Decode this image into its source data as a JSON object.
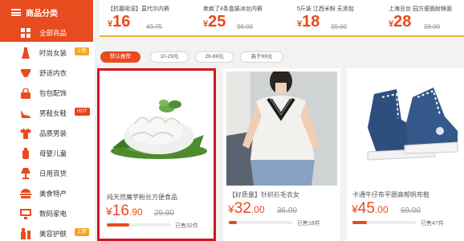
{
  "sidebar": {
    "header": "商品分类",
    "items": [
      {
        "label": "全部商品",
        "icon": "grid-icon",
        "active": true
      },
      {
        "label": "时尚女装",
        "icon": "dress-icon",
        "tag": "上新",
        "tag_type": "new"
      },
      {
        "label": "舒适内衣",
        "icon": "underwear-icon"
      },
      {
        "label": "包包配饰",
        "icon": "handbag-icon"
      },
      {
        "label": "男鞋女鞋",
        "icon": "high-heel-icon",
        "tag": "HOT",
        "tag_type": "hot"
      },
      {
        "label": "品质男装",
        "icon": "shirt-icon"
      },
      {
        "label": "母婴儿童",
        "icon": "baby-bottle-icon"
      },
      {
        "label": "日用百货",
        "icon": "lamp-icon"
      },
      {
        "label": "美食特产",
        "icon": "burger-icon"
      },
      {
        "label": "数码家电",
        "icon": "monitor-icon"
      },
      {
        "label": "美容护肤",
        "icon": "cosmetics-icon",
        "tag": "上新",
        "tag_type": "new"
      }
    ]
  },
  "deals": [
    {
      "title": "【抗菌吸湿】莫代尔内裤",
      "price_symbol": "¥",
      "price": "16",
      "old_price": "49.75"
    },
    {
      "title": "卖疯了4条盒装冰丝内裤",
      "price_symbol": "¥",
      "price": "25",
      "old_price": "98.00"
    },
    {
      "title": "5斤装 江西米粉 无添加",
      "price_symbol": "¥",
      "price": "18",
      "old_price": "39.60"
    },
    {
      "title": "上海豆丝 园方便面耐镁面",
      "price_symbol": "¥",
      "price": "28",
      "old_price": "38.00"
    }
  ],
  "filters": [
    {
      "label": "默认推荐",
      "active": true
    },
    {
      "label": "10-29元"
    },
    {
      "label": "29-69元"
    },
    {
      "label": "高于69元"
    }
  ],
  "products": [
    {
      "title": "纯天然魔芋粉丝方便食品",
      "price_symbol": "¥",
      "price_int": "16",
      "price_dec": ".90",
      "old_price": "29.90",
      "sold": "已售32件",
      "progress": 0.35,
      "selected": true
    },
    {
      "title": "【好质量】针织衫毛衣女",
      "price_symbol": "¥",
      "price_int": "32",
      "price_dec": ".00",
      "old_price": "36.00",
      "sold": "已售18件",
      "progress": 0.12
    },
    {
      "title": "卡通牛仔布平跟高帮帆布鞋",
      "price_symbol": "¥",
      "price_int": "45",
      "price_dec": ".00",
      "old_price": "69.00",
      "sold": "已售47件",
      "progress": 0.22
    }
  ],
  "colors": {
    "accent": "#e84b1e",
    "selected_border": "#d4161e",
    "topbar_border": "#f3b43b"
  }
}
